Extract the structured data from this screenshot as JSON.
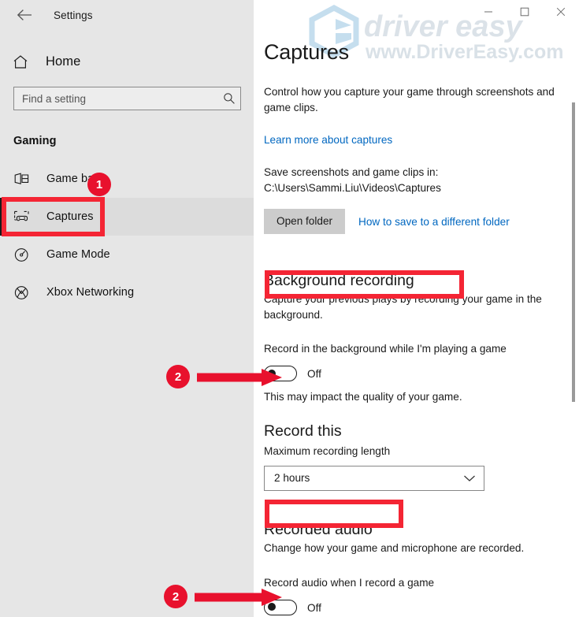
{
  "window": {
    "app_title": "Settings",
    "back_icon": "back-arrow-icon",
    "minimize_label": "—",
    "maximize_label": "□",
    "close_label": "✕"
  },
  "watermark": {
    "brand_line1": "driver easy",
    "brand_line2": "www.DriverEasy.com",
    "logo_color": "#bcd9ec",
    "text_color": "#d7dee4"
  },
  "sidebar": {
    "home_label": "Home",
    "home_icon": "home-icon",
    "search": {
      "placeholder": "Find a setting",
      "value": "",
      "icon": "search-icon"
    },
    "group_title": "Gaming",
    "items": [
      {
        "label": "Game bar",
        "icon": "game-bar-icon",
        "selected": false
      },
      {
        "label": "Captures",
        "icon": "captures-icon",
        "selected": true
      },
      {
        "label": "Game Mode",
        "icon": "game-mode-icon",
        "selected": false
      },
      {
        "label": "Xbox Networking",
        "icon": "xbox-icon",
        "selected": false
      }
    ]
  },
  "main": {
    "page_title": "Captures",
    "intro": "Control how you capture your game through screenshots and game clips.",
    "learn_more_link": "Learn more about captures",
    "save_path_text": "Save screenshots and game clips in: C:\\Users\\Sammi.Liu\\Videos\\Captures",
    "open_folder_button": "Open folder",
    "different_folder_link": "How to save to a different folder",
    "sections": [
      {
        "heading": "Background recording",
        "description": "Capture your previous plays by recording your game in the background.",
        "toggle_label": "Record in the background while I'm playing a game",
        "toggle_state": "Off",
        "note": "This may impact the quality of your game."
      },
      {
        "heading": "Record this",
        "field_label": "Maximum recording length",
        "select_value": "2 hours",
        "select_icon": "chevron-down-icon"
      },
      {
        "heading": "Recorded audio",
        "description": "Change how your game and microphone are recorded.",
        "toggle_label": "Record audio when I record a game",
        "toggle_state": "Off"
      }
    ]
  },
  "annotations": {
    "badge1": "1",
    "badge2a": "2",
    "badge2b": "2",
    "color": "#e8112d",
    "box_color": "#f42534"
  }
}
